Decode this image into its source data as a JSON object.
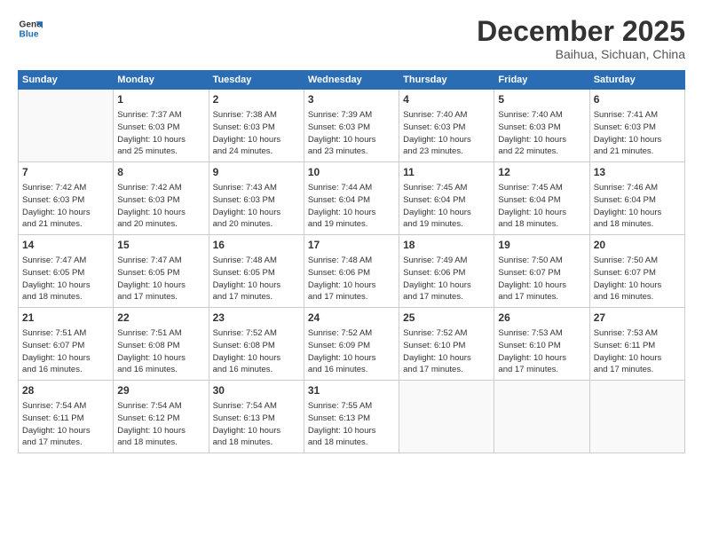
{
  "header": {
    "logo_line1": "General",
    "logo_line2": "Blue",
    "title": "December 2025",
    "subtitle": "Baihua, Sichuan, China"
  },
  "weekdays": [
    "Sunday",
    "Monday",
    "Tuesday",
    "Wednesday",
    "Thursday",
    "Friday",
    "Saturday"
  ],
  "weeks": [
    [
      {
        "day": "",
        "info": ""
      },
      {
        "day": "1",
        "info": "Sunrise: 7:37 AM\nSunset: 6:03 PM\nDaylight: 10 hours\nand 25 minutes."
      },
      {
        "day": "2",
        "info": "Sunrise: 7:38 AM\nSunset: 6:03 PM\nDaylight: 10 hours\nand 24 minutes."
      },
      {
        "day": "3",
        "info": "Sunrise: 7:39 AM\nSunset: 6:03 PM\nDaylight: 10 hours\nand 23 minutes."
      },
      {
        "day": "4",
        "info": "Sunrise: 7:40 AM\nSunset: 6:03 PM\nDaylight: 10 hours\nand 23 minutes."
      },
      {
        "day": "5",
        "info": "Sunrise: 7:40 AM\nSunset: 6:03 PM\nDaylight: 10 hours\nand 22 minutes."
      },
      {
        "day": "6",
        "info": "Sunrise: 7:41 AM\nSunset: 6:03 PM\nDaylight: 10 hours\nand 21 minutes."
      }
    ],
    [
      {
        "day": "7",
        "info": "Sunrise: 7:42 AM\nSunset: 6:03 PM\nDaylight: 10 hours\nand 21 minutes."
      },
      {
        "day": "8",
        "info": "Sunrise: 7:42 AM\nSunset: 6:03 PM\nDaylight: 10 hours\nand 20 minutes."
      },
      {
        "day": "9",
        "info": "Sunrise: 7:43 AM\nSunset: 6:03 PM\nDaylight: 10 hours\nand 20 minutes."
      },
      {
        "day": "10",
        "info": "Sunrise: 7:44 AM\nSunset: 6:04 PM\nDaylight: 10 hours\nand 19 minutes."
      },
      {
        "day": "11",
        "info": "Sunrise: 7:45 AM\nSunset: 6:04 PM\nDaylight: 10 hours\nand 19 minutes."
      },
      {
        "day": "12",
        "info": "Sunrise: 7:45 AM\nSunset: 6:04 PM\nDaylight: 10 hours\nand 18 minutes."
      },
      {
        "day": "13",
        "info": "Sunrise: 7:46 AM\nSunset: 6:04 PM\nDaylight: 10 hours\nand 18 minutes."
      }
    ],
    [
      {
        "day": "14",
        "info": "Sunrise: 7:47 AM\nSunset: 6:05 PM\nDaylight: 10 hours\nand 18 minutes."
      },
      {
        "day": "15",
        "info": "Sunrise: 7:47 AM\nSunset: 6:05 PM\nDaylight: 10 hours\nand 17 minutes."
      },
      {
        "day": "16",
        "info": "Sunrise: 7:48 AM\nSunset: 6:05 PM\nDaylight: 10 hours\nand 17 minutes."
      },
      {
        "day": "17",
        "info": "Sunrise: 7:48 AM\nSunset: 6:06 PM\nDaylight: 10 hours\nand 17 minutes."
      },
      {
        "day": "18",
        "info": "Sunrise: 7:49 AM\nSunset: 6:06 PM\nDaylight: 10 hours\nand 17 minutes."
      },
      {
        "day": "19",
        "info": "Sunrise: 7:50 AM\nSunset: 6:07 PM\nDaylight: 10 hours\nand 17 minutes."
      },
      {
        "day": "20",
        "info": "Sunrise: 7:50 AM\nSunset: 6:07 PM\nDaylight: 10 hours\nand 16 minutes."
      }
    ],
    [
      {
        "day": "21",
        "info": "Sunrise: 7:51 AM\nSunset: 6:07 PM\nDaylight: 10 hours\nand 16 minutes."
      },
      {
        "day": "22",
        "info": "Sunrise: 7:51 AM\nSunset: 6:08 PM\nDaylight: 10 hours\nand 16 minutes."
      },
      {
        "day": "23",
        "info": "Sunrise: 7:52 AM\nSunset: 6:08 PM\nDaylight: 10 hours\nand 16 minutes."
      },
      {
        "day": "24",
        "info": "Sunrise: 7:52 AM\nSunset: 6:09 PM\nDaylight: 10 hours\nand 16 minutes."
      },
      {
        "day": "25",
        "info": "Sunrise: 7:52 AM\nSunset: 6:10 PM\nDaylight: 10 hours\nand 17 minutes."
      },
      {
        "day": "26",
        "info": "Sunrise: 7:53 AM\nSunset: 6:10 PM\nDaylight: 10 hours\nand 17 minutes."
      },
      {
        "day": "27",
        "info": "Sunrise: 7:53 AM\nSunset: 6:11 PM\nDaylight: 10 hours\nand 17 minutes."
      }
    ],
    [
      {
        "day": "28",
        "info": "Sunrise: 7:54 AM\nSunset: 6:11 PM\nDaylight: 10 hours\nand 17 minutes."
      },
      {
        "day": "29",
        "info": "Sunrise: 7:54 AM\nSunset: 6:12 PM\nDaylight: 10 hours\nand 18 minutes."
      },
      {
        "day": "30",
        "info": "Sunrise: 7:54 AM\nSunset: 6:13 PM\nDaylight: 10 hours\nand 18 minutes."
      },
      {
        "day": "31",
        "info": "Sunrise: 7:55 AM\nSunset: 6:13 PM\nDaylight: 10 hours\nand 18 minutes."
      },
      {
        "day": "",
        "info": ""
      },
      {
        "day": "",
        "info": ""
      },
      {
        "day": "",
        "info": ""
      }
    ]
  ]
}
